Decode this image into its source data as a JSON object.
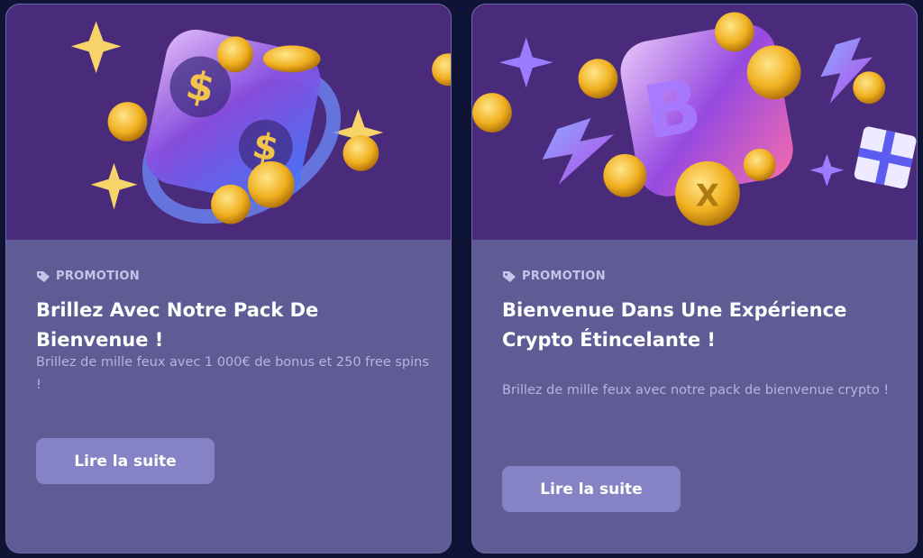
{
  "cards": [
    {
      "tag": "PROMOTION",
      "title": "Brillez Avec Notre Pack De Bienvenue !",
      "description": "Brillez de mille feux avec 1 000€ de bonus et 250 free spins !",
      "button": "Lire la suite",
      "hero_icons": [
        "dice-dollar-icon",
        "gold-coin-icon",
        "sparkle-star-icon"
      ]
    },
    {
      "tag": "PROMOTION",
      "title": "Bienvenue Dans Une Expérience Crypto Étincelante !",
      "description": "Brillez de mille feux avec notre pack de bienvenue crypto !",
      "button": "Lire la suite",
      "hero_icons": [
        "dice-bitcoin-icon",
        "gold-coin-icon",
        "lightning-icon",
        "gift-box-icon",
        "sparkle-star-icon"
      ]
    }
  ],
  "colors": {
    "page_bg": "#0f1437",
    "card_bg": "#5f5c95",
    "hero_bg": "#4a2a7a",
    "button_bg": "#8682c6",
    "tag_text": "#c7c3ea",
    "desc_text": "#b7b4e2"
  }
}
